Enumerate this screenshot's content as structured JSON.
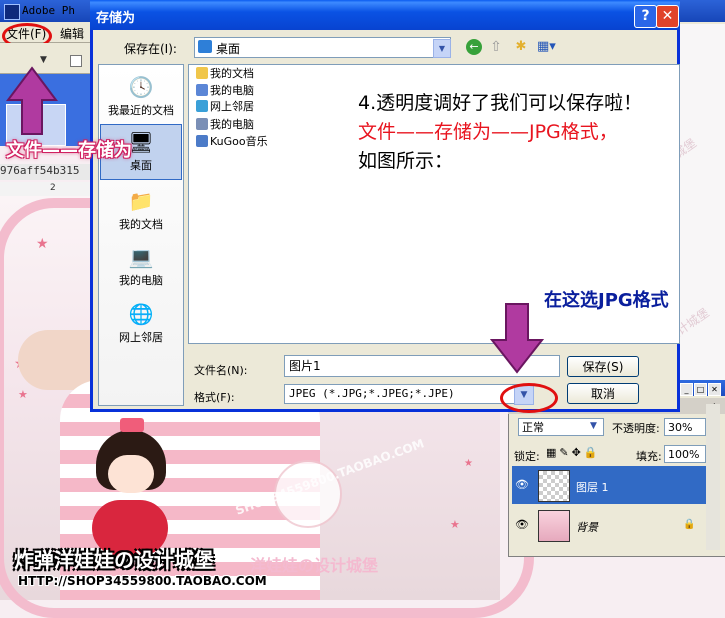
{
  "photoshop": {
    "title": "Adobe Ph",
    "menu": [
      "文件(F)",
      "编辑"
    ],
    "document_name": "976aff54b315",
    "ruler_number": "2"
  },
  "dialog": {
    "title": "存储为",
    "help_glyph": "?",
    "close_glyph": "✕",
    "save_in_label": "保存在(I):",
    "save_in_value": "桌面",
    "places": [
      {
        "label": "我最近的文档",
        "icon": "recent-documents-icon"
      },
      {
        "label": "桌面",
        "icon": "desktop-icon"
      },
      {
        "label": "我的文档",
        "icon": "my-documents-icon"
      },
      {
        "label": "我的电脑",
        "icon": "my-computer-icon"
      },
      {
        "label": "网上邻居",
        "icon": "network-places-icon"
      }
    ],
    "files": [
      {
        "name": "我的文档",
        "icon": "folder-icon"
      },
      {
        "name": "我的电脑",
        "icon": "computer-icon"
      },
      {
        "name": "网上邻居",
        "icon": "network-icon"
      },
      {
        "name": "我的电脑",
        "icon": "shortcut-computer-icon"
      },
      {
        "name": "KuGoo音乐",
        "icon": "shortcut-music-icon"
      }
    ],
    "filename_label": "文件名(N):",
    "filename_value": "图片1",
    "format_label": "格式(F):",
    "format_value": "JPEG (*.JPG;*.JPEG;*.JPE)",
    "save_button": "保存(S)",
    "cancel_button": "取消"
  },
  "layers_panel": {
    "blend_mode": "正常",
    "opacity_label": "不透明度:",
    "opacity_value": "30%",
    "lock_label": "锁定:",
    "fill_label": "填充:",
    "fill_value": "100%",
    "layers": [
      {
        "name": "图层 1",
        "selected": true
      },
      {
        "name": "背景",
        "selected": false
      }
    ]
  },
  "annotations": {
    "step_line1": "4.透明度调好了我们可以保存啦！",
    "step_line2": "文件——存储为——JPG格式，",
    "step_line3": "如图所示：",
    "format_hint": "在这选JPG格式",
    "menu_hint": "文件——存储为"
  },
  "watermark": {
    "url_diagonal": "SHOP34559800.TAOBAO.COM",
    "brand": "炸弹洋娃娃の设计城堡",
    "url": "HTTP://SHOP34559800.TAOBAO.COM"
  },
  "colors": {
    "xp_blue": "#0831d9",
    "annotation_red": "#e8141f",
    "annotation_blue": "#0a1f9d",
    "arrow_magenta": "#b03aa0",
    "selection_blue": "#316ac5"
  }
}
